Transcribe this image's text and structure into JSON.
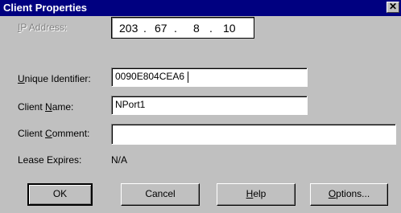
{
  "window": {
    "title": "Client Properties",
    "close_glyph": "✕"
  },
  "fields": {
    "ip_address": {
      "label_pre": "",
      "label_key": "I",
      "label_post": "P Address:",
      "segments": [
        "203",
        "67",
        "8",
        "10"
      ]
    },
    "unique_identifier": {
      "label_pre": "",
      "label_key": "U",
      "label_post": "nique Identifier:",
      "value": "0090E804CEA6"
    },
    "client_name": {
      "label_pre": "Client ",
      "label_key": "N",
      "label_post": "ame:",
      "value": "NPort1"
    },
    "client_comment": {
      "label_pre": "Client ",
      "label_key": "C",
      "label_post": "omment:",
      "value": ""
    },
    "lease_expires": {
      "label": "Lease Expires:",
      "value": "N/A"
    }
  },
  "buttons": {
    "ok": "OK",
    "cancel": "Cancel",
    "help_key": "H",
    "help_rest": "elp",
    "options_key": "O",
    "options_rest": "ptions..."
  },
  "icons": {
    "close": "close-icon"
  }
}
